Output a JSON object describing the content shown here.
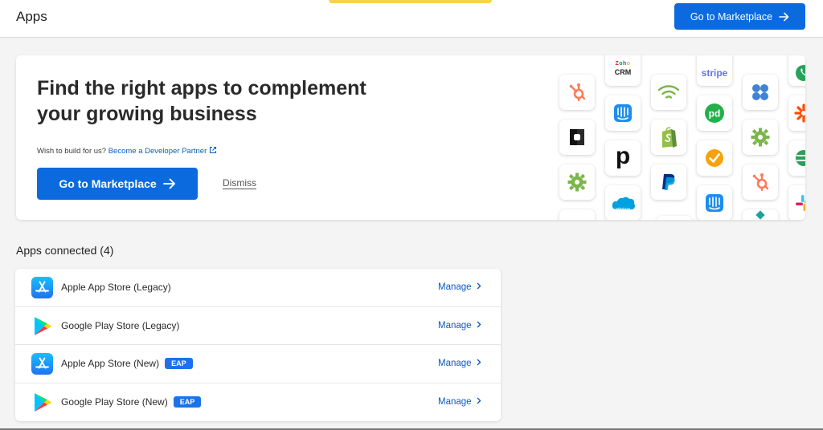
{
  "header": {
    "title": "Apps",
    "marketplace_label": "Go to Marketplace"
  },
  "hero": {
    "heading": "Find the right apps to complement your growing business",
    "sub_text": "Wish to build for us?",
    "partner_link": "Become a Developer Partner",
    "cta_label": "Go to Marketplace",
    "dismiss_label": "Dismiss",
    "tile_texts": {
      "crm_top": "Zoho",
      "crm_bottom": "CRM",
      "stripe": "stripe",
      "p": "p",
      "salesforce": "salesforce"
    }
  },
  "connected": {
    "title": "Apps connected (4)",
    "manage_label": "Manage",
    "apps": [
      {
        "name": "Apple App Store (Legacy)",
        "badge": "",
        "icon": "app-store-icon"
      },
      {
        "name": "Google Play Store (Legacy)",
        "badge": "",
        "icon": "google-play-icon"
      },
      {
        "name": "Apple App Store (New)",
        "badge": "EAP",
        "icon": "app-store-icon"
      },
      {
        "name": "Google Play Store (New)",
        "badge": "EAP",
        "icon": "google-play-icon"
      }
    ]
  },
  "colors": {
    "primary": "#0b6bde",
    "link": "#0b5cbf",
    "badge": "#1a73e8",
    "accent_yellow": "#f8d24a"
  }
}
